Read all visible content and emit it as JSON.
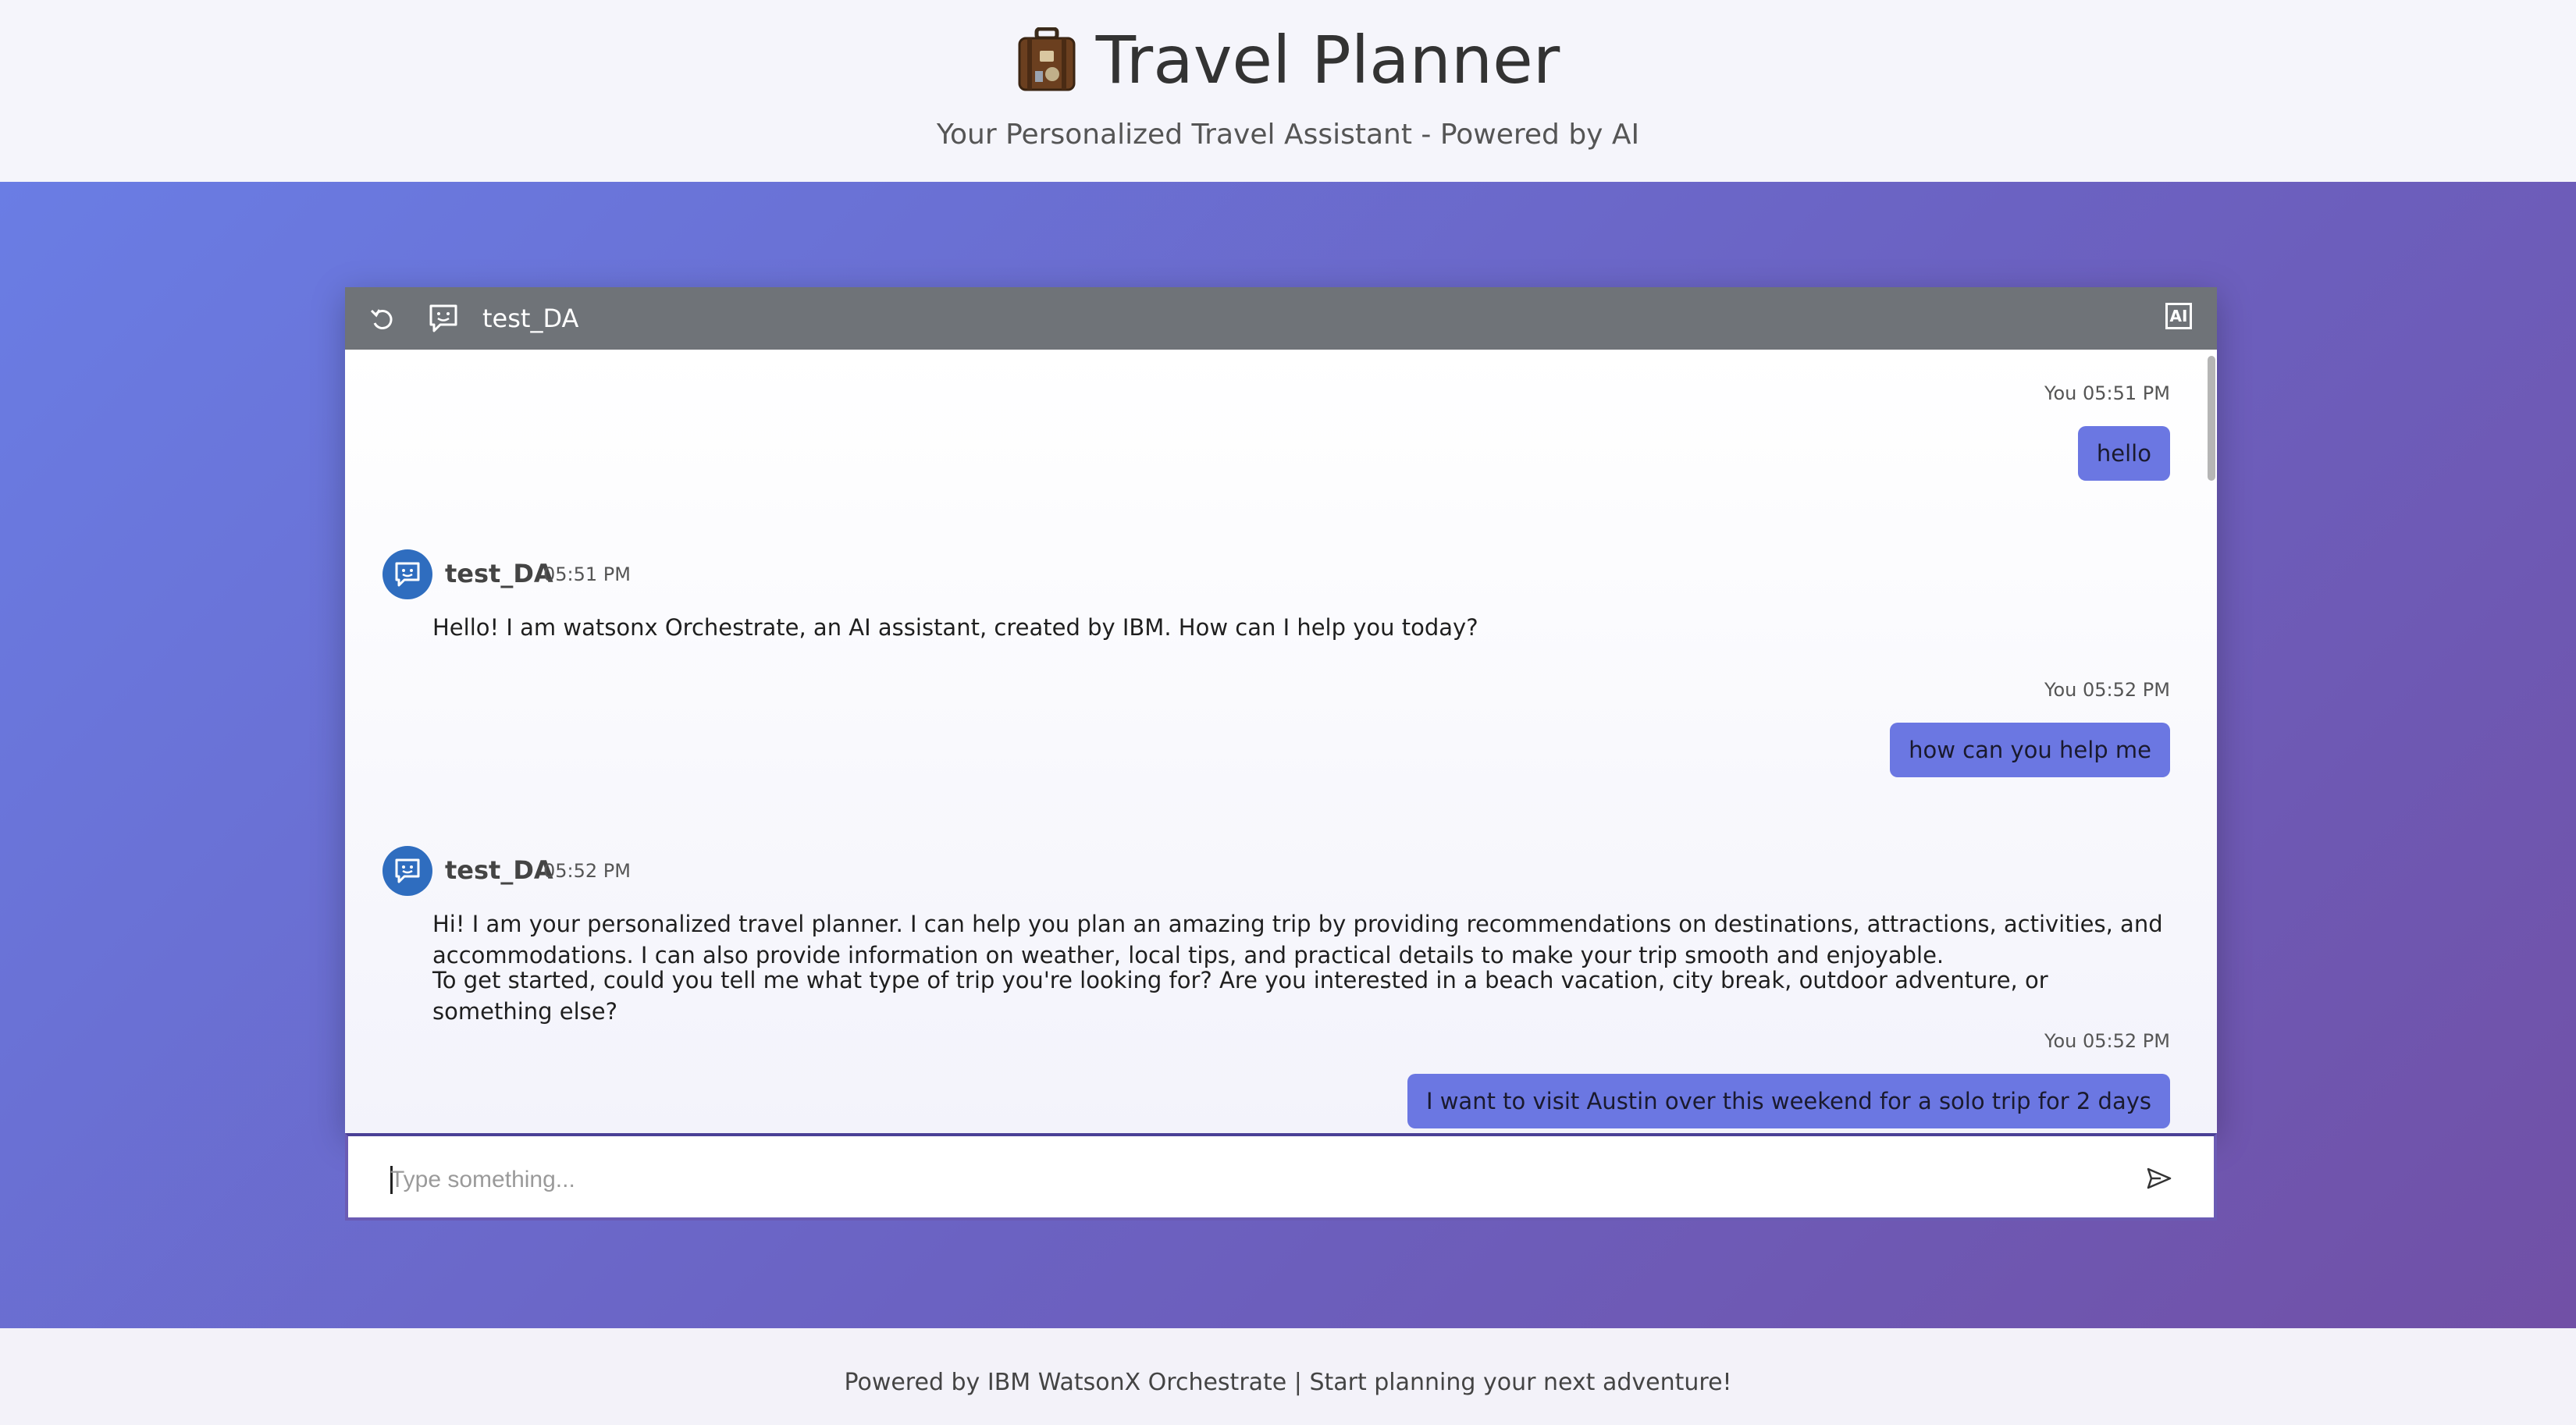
{
  "header": {
    "title": "Travel Planner",
    "subtitle": "Your Personalized Travel Assistant - Powered by AI"
  },
  "chat": {
    "agent_name": "test_DA",
    "ai_badge": "AI",
    "messages": [
      {
        "sender": "You",
        "time": "05:51 PM",
        "text": "hello"
      },
      {
        "sender": "test_DA",
        "time": "05:51 PM",
        "text": "Hello! I am watsonx Orchestrate, an AI assistant, created by IBM. How can I help you today?"
      },
      {
        "sender": "You",
        "time": "05:52 PM",
        "text": "how can you help me"
      },
      {
        "sender": "test_DA",
        "time": "05:52 PM",
        "text": "Hi! I am your personalized travel planner. I can help you plan an amazing trip by providing recommendations on destinations, attractions, activities, and accommodations. I can also provide information on weather, local tips, and practical details to make your trip smooth and enjoyable.",
        "text2": "To get started, could you tell me what type of trip you're looking for? Are you interested in a beach vacation, city break, outdoor adventure, or something else?"
      },
      {
        "sender": "You",
        "time": "05:52 PM",
        "text": "I want to visit Austin over this weekend for a solo trip for 2 days"
      }
    ],
    "input_placeholder": "Type something..."
  },
  "footer": {
    "text": "Powered by IBM WatsonX Orchestrate | Start planning your next adventure!"
  },
  "colors": {
    "accent": "#6b77e2",
    "header_bar": "#6f7378",
    "avatar": "#2f6dbf"
  }
}
